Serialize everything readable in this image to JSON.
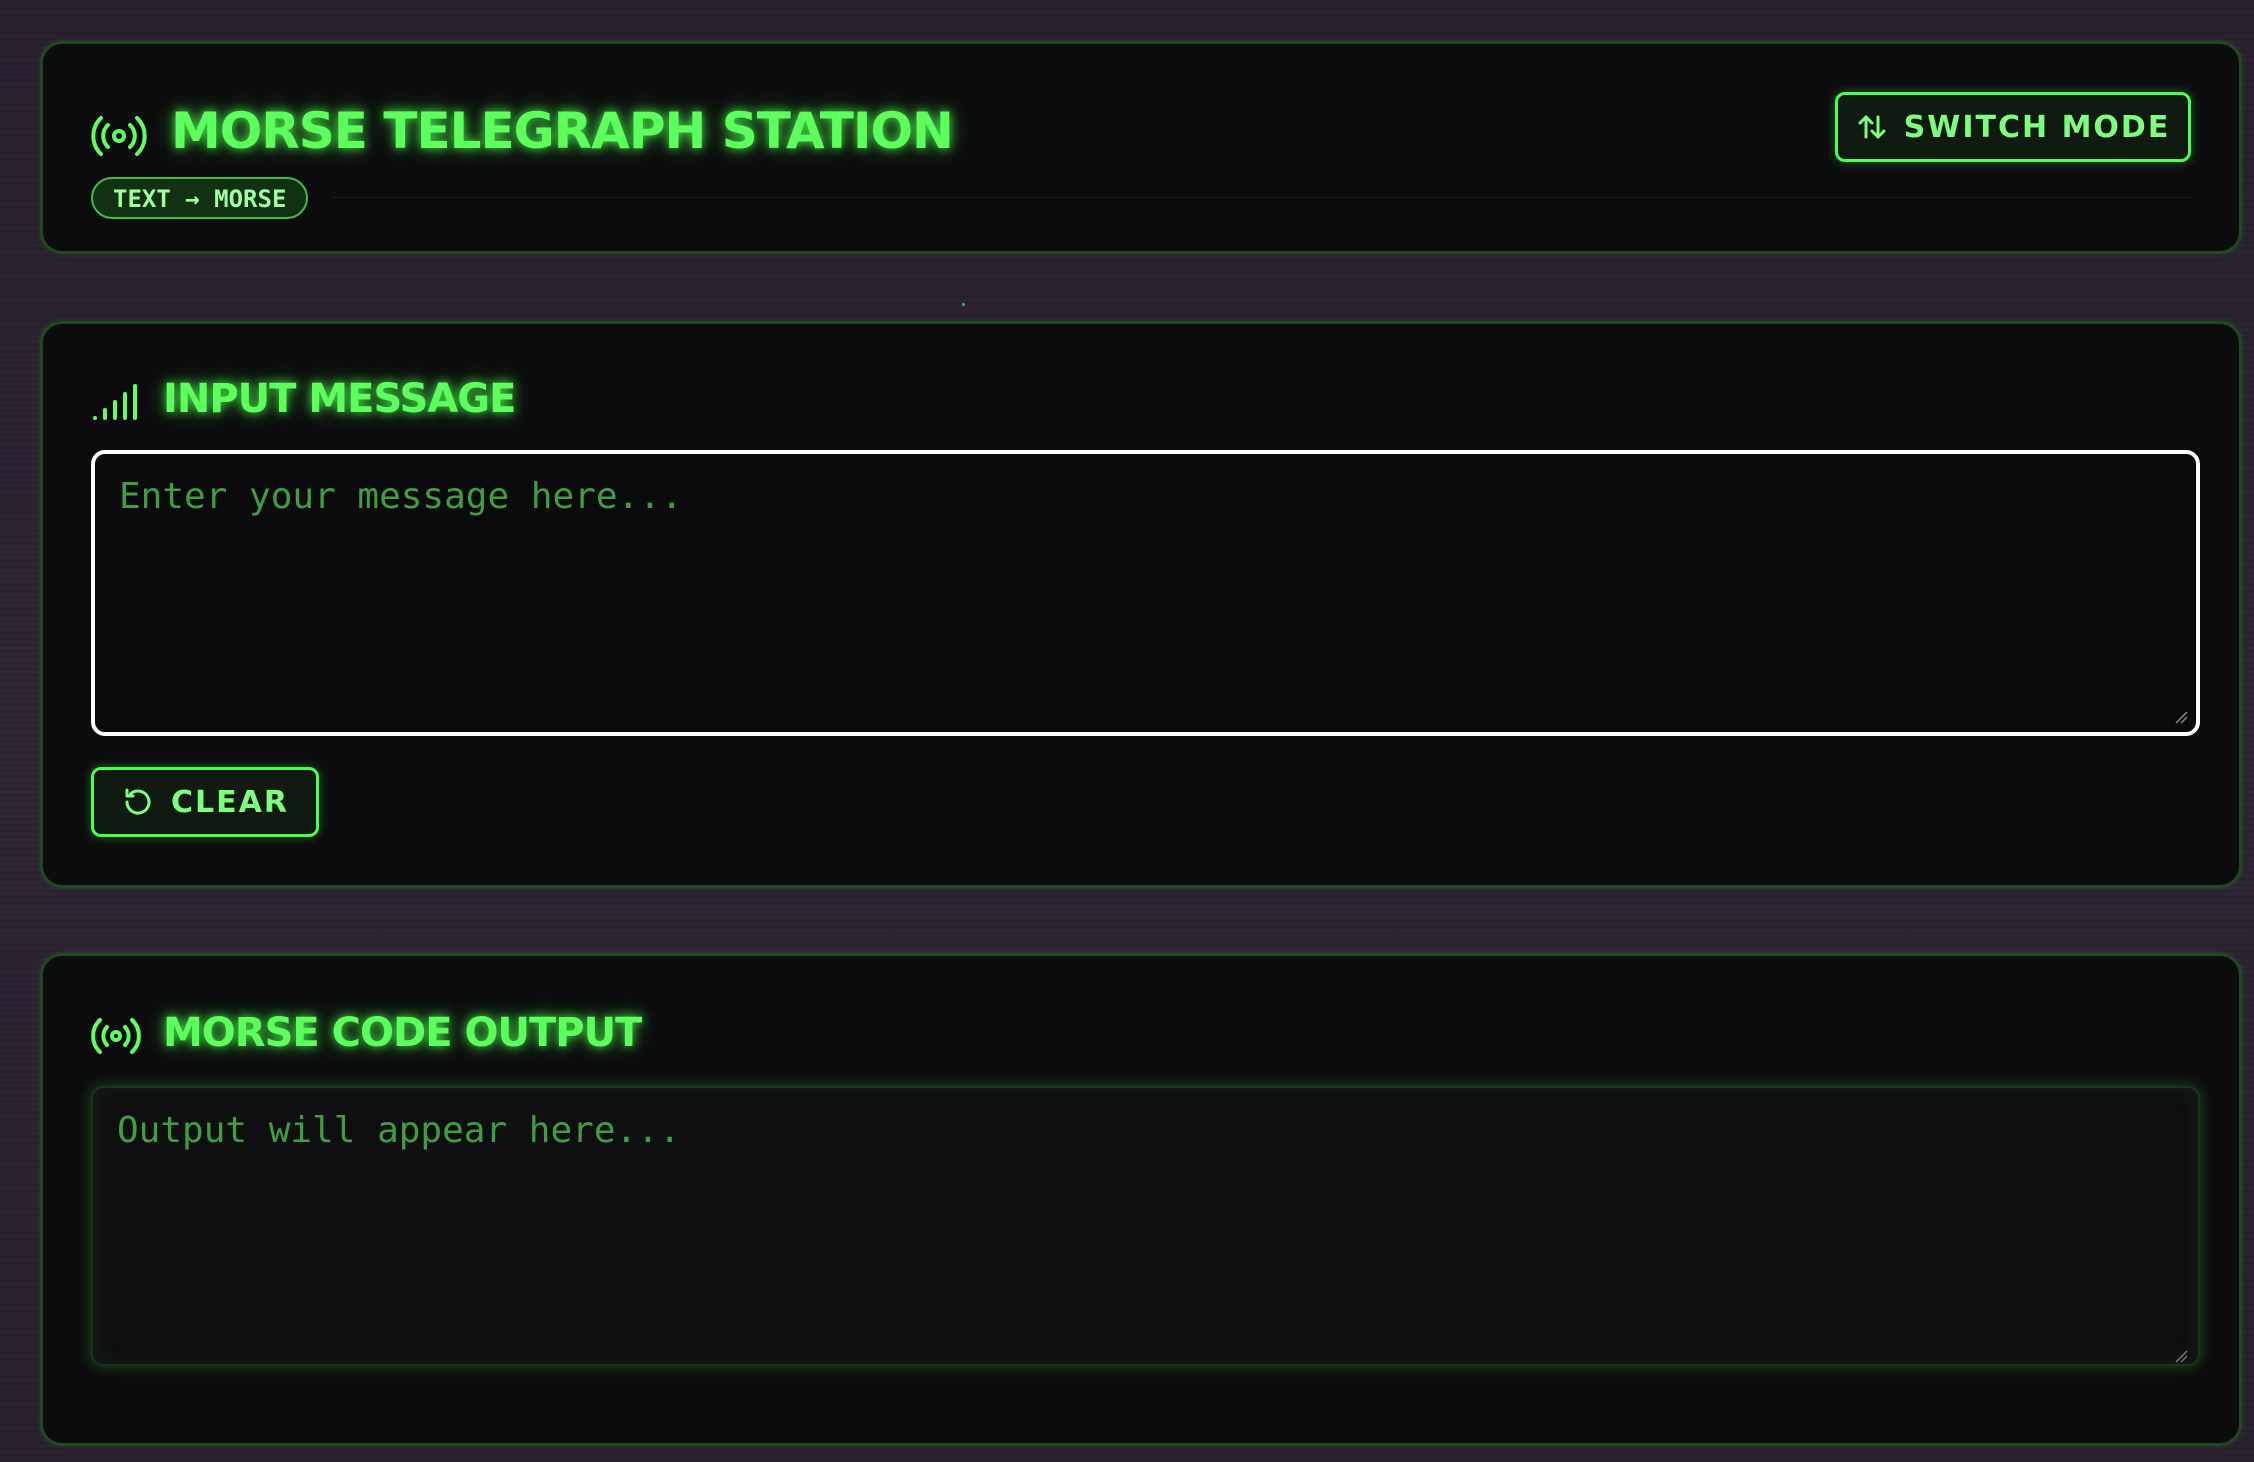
{
  "header": {
    "title": "MORSE TELEGRAPH STATION",
    "mode_badge": "TEXT → MORSE",
    "switch_button_label": "SWITCH MODE",
    "title_icon": "broadcast-icon",
    "switch_icon": "swap-vertical-icon"
  },
  "input_section": {
    "title": "INPUT MESSAGE",
    "icon": "signal-bars-icon",
    "placeholder": "Enter your message here...",
    "value": "",
    "clear_button_label": "CLEAR",
    "clear_icon": "rotate-ccw-icon"
  },
  "output_section": {
    "title": "MORSE CODE OUTPUT",
    "icon": "broadcast-icon",
    "placeholder": "Output will appear here...",
    "value": ""
  },
  "colors": {
    "accent": "#4cff4c",
    "background": "#2b2430",
    "panel": "#0c0c0e",
    "input_border": "#ffffff"
  }
}
